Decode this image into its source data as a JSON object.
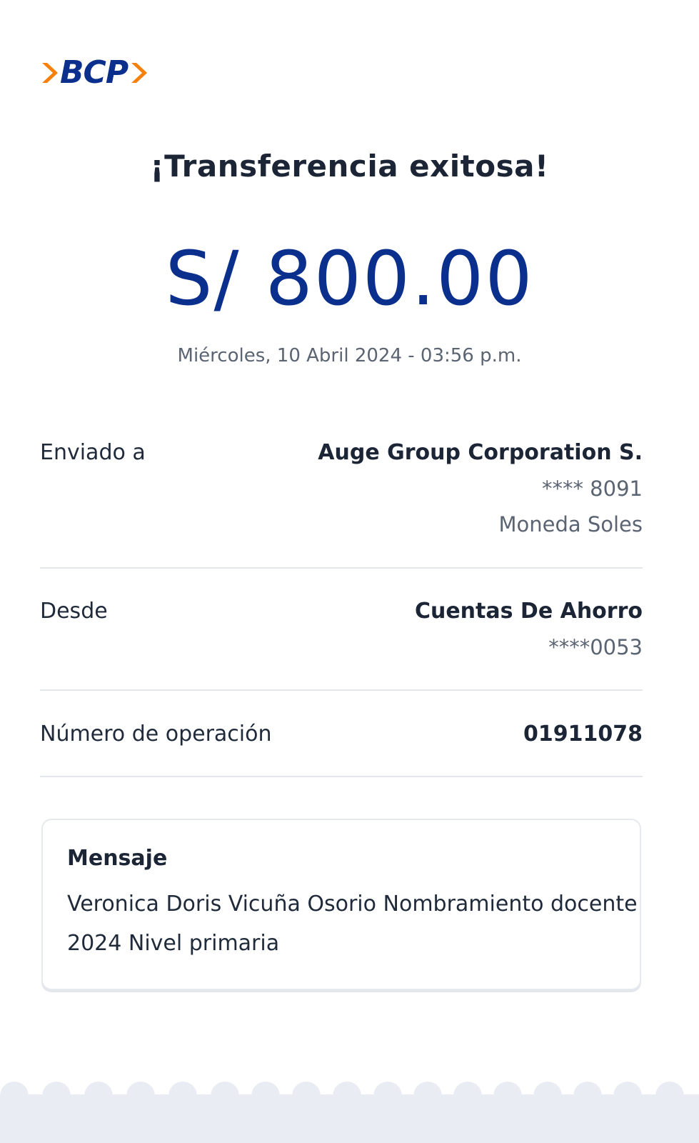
{
  "brand": {
    "logo_text": "BCP",
    "primary_color": "#0b2f8c",
    "accent_color": "#f7800a"
  },
  "title": "¡Transferencia exitosa!",
  "amount": "S/ 800.00",
  "datetime": "Miércoles, 10 Abril 2024 - 03:56 p.m.",
  "sent_to": {
    "label": "Enviado a",
    "name": "Auge Group Corporation S.",
    "account": "**** 8091",
    "currency": "Moneda Soles"
  },
  "from": {
    "label": "Desde",
    "account_type": "Cuentas De Ahorro",
    "account": "****0053"
  },
  "operation": {
    "label": "Número de operación",
    "number": "01911078"
  },
  "message": {
    "title": "Mensaje",
    "body": "Veronica Doris Vicuña Osorio Nombramiento docente 2024 Nivel primaria"
  }
}
